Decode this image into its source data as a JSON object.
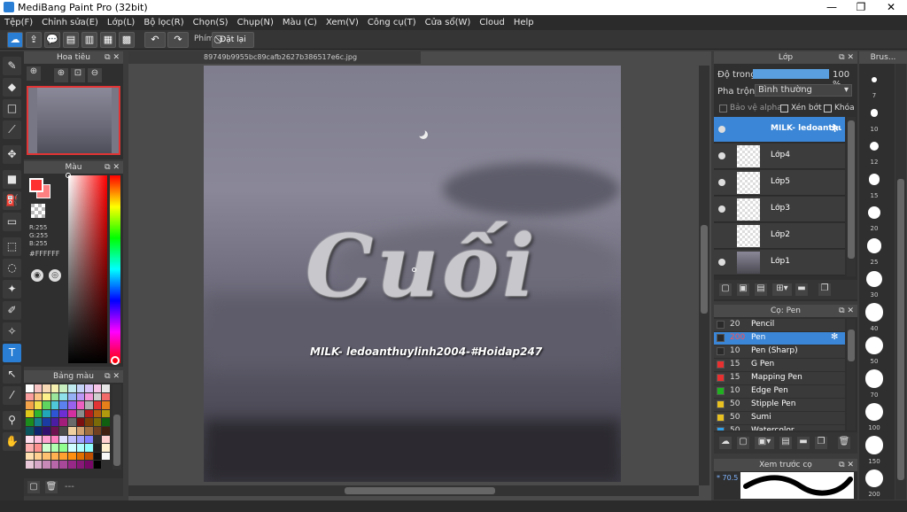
{
  "window": {
    "title": "MediBang Paint Pro (32bit)",
    "min": "—",
    "max": "❐",
    "close": "✕"
  },
  "menu": [
    "Tệp(F)",
    "Chỉnh sửa(E)",
    "Lớp(L)",
    "Bộ lọc(R)",
    "Chọn(S)",
    "Chụp(N)",
    "Màu (C)",
    "Xem(V)",
    "Công cụ(T)",
    "Cửa sổ(W)",
    "Cloud",
    "Help"
  ],
  "toolbar": {
    "shortcut_label": "Phím",
    "reset_label": "Đặt lại"
  },
  "canvas": {
    "filename": "89749b9955bc89cafb2627b386517e6c.jpg",
    "watermark": "MILK- ledoanthuylinh2004-#Hoidap247",
    "lettering": "Cuối"
  },
  "navigator": {
    "title": "Hoa tiêu"
  },
  "color_panel": {
    "title": "Màu",
    "r": "R:255",
    "g": "G:255",
    "b": "B:255",
    "hex": "#FFFFFF",
    "primary": "#ff3030",
    "secondary": "#ff8080"
  },
  "palette": {
    "title": "Bảng màu",
    "footer": "---",
    "swatches": [
      "#ffffff",
      "#f6c2c2",
      "#f7d9b5",
      "#f6f0b0",
      "#c9efc0",
      "#c0e9ef",
      "#c5d2f7",
      "#d9c5f7",
      "#f7c5e8",
      "#e6e6e6",
      "#fb9e9e",
      "#fbc486",
      "#fbf08a",
      "#9ae69a",
      "#8ee0ea",
      "#96b0f5",
      "#bb98f5",
      "#f598d9",
      "#cfcfcf",
      "#f26b6b",
      "#f5a34a",
      "#f2e04a",
      "#5fd45f",
      "#4fc9d9",
      "#5b81ee",
      "#9861ee",
      "#ee5fc2",
      "#b0b0b0",
      "#e23434",
      "#e67e1a",
      "#e0c81a",
      "#2eb52e",
      "#22a7b8",
      "#2d55d4",
      "#6d2fd4",
      "#d42fa0",
      "#8c8c8c",
      "#b81c1c",
      "#b35e0e",
      "#b09a0e",
      "#1c8c1c",
      "#157f8c",
      "#1b3ca3",
      "#4b1da3",
      "#a31d7a",
      "#6a6a6a",
      "#7a1010",
      "#7a3f08",
      "#7a6a08",
      "#105e10",
      "#0d565e",
      "#10266e",
      "#32126e",
      "#6e1252",
      "#4a4a4a",
      "#f0d0a0",
      "#d0a070",
      "#a07040",
      "#704020",
      "#402010",
      "#ffe0f0",
      "#ffc0e0",
      "#ffa0d0",
      "#ff80c0",
      "#e0e0ff",
      "#c0c0ff",
      "#a0a0ff",
      "#8080ff",
      "#303030",
      "#ffd0d0",
      "#ffb0b0",
      "#ff9090",
      "#d0ffd0",
      "#b0ffb0",
      "#90ff90",
      "#d0ffff",
      "#b0ffff",
      "#90ffff",
      "#202020",
      "#fff0d0",
      "#ffe0b0",
      "#ffd090",
      "#ffc070",
      "#ffb050",
      "#ffa030",
      "#ff9010",
      "#e07000",
      "#c05000",
      "#101010",
      "#f8f8f8",
      "#e8c8d8",
      "#d8a8c8",
      "#c888b8",
      "#b868a8",
      "#a84898",
      "#982888",
      "#881878",
      "#780868",
      "#000000"
    ]
  },
  "layer_panel": {
    "title": "Lớp",
    "opacity_label": "Độ trong",
    "opacity_value": "100 %",
    "opacity": 1.0,
    "blend_label": "Pha trộn",
    "blend_value": "Bình thường",
    "protect_alpha": "Bảo vệ alpha",
    "clipping": "Xén bớt",
    "lock": "Khóa",
    "layers": [
      {
        "name": "MILK- ledoanthuylinh2004",
        "visible": true,
        "selected": true
      },
      {
        "name": "Lớp4",
        "visible": true,
        "selected": false
      },
      {
        "name": "Lớp5",
        "visible": true,
        "selected": false
      },
      {
        "name": "Lớp3",
        "visible": true,
        "selected": false
      },
      {
        "name": "Lớp2",
        "visible": false,
        "selected": false
      },
      {
        "name": "Lớp1",
        "visible": true,
        "selected": false
      }
    ]
  },
  "brush_list": {
    "title": "Cọ: Pen",
    "items": [
      {
        "size": "20",
        "name": "Pencil",
        "color": "#2a2a2a",
        "selected": false
      },
      {
        "size": "200",
        "name": "Pen",
        "color": "#2a2a2a",
        "selected": true
      },
      {
        "size": "10",
        "name": "Pen (Sharp)",
        "color": "#2a2a2a",
        "selected": false
      },
      {
        "size": "15",
        "name": "G Pen",
        "color": "#e83030",
        "selected": false
      },
      {
        "size": "15",
        "name": "Mapping Pen",
        "color": "#e83030",
        "selected": false
      },
      {
        "size": "10",
        "name": "Edge Pen",
        "color": "#20b020",
        "selected": false
      },
      {
        "size": "50",
        "name": "Stipple Pen",
        "color": "#e8c020",
        "selected": false
      },
      {
        "size": "50",
        "name": "Sumi",
        "color": "#e8c020",
        "selected": false
      },
      {
        "size": "50",
        "name": "Watercolor",
        "color": "#30a0e8",
        "selected": false
      }
    ]
  },
  "brush_preview": {
    "title": "Xem trước cọ",
    "value": "* 70.5"
  },
  "brush_size": {
    "title": "Brus...",
    "sizes": [
      "7",
      "10",
      "12",
      "15",
      "20",
      "25",
      "30",
      "40",
      "50",
      "70",
      "100",
      "150",
      "200"
    ]
  }
}
